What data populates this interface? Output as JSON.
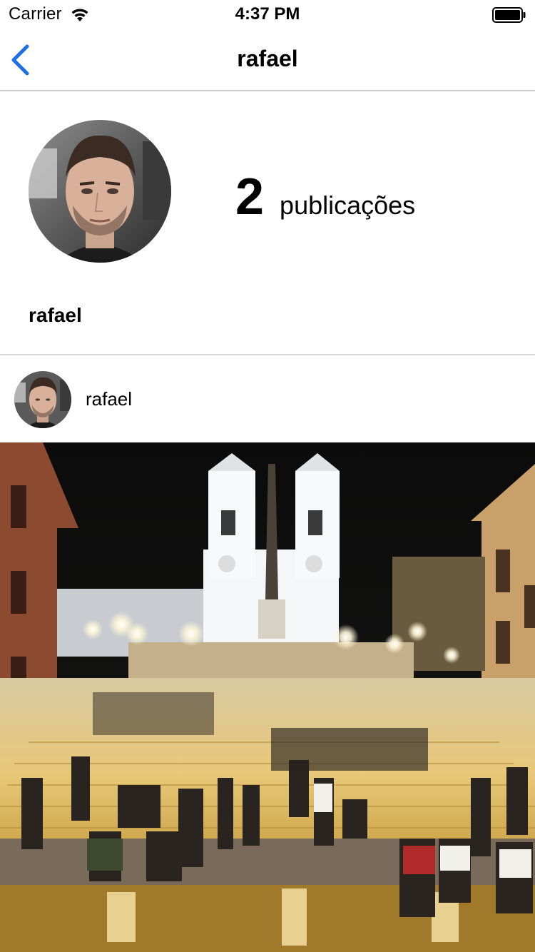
{
  "status_bar": {
    "carrier": "Carrier",
    "time": "4:37 PM",
    "wifi_icon": "wifi-icon",
    "battery_icon": "battery-icon",
    "battery_level": 1.0
  },
  "nav": {
    "title": "rafael",
    "back_icon": "chevron-left-icon",
    "accent_color": "#1e6fe6"
  },
  "profile": {
    "avatar_icon": "profile-avatar-photo",
    "post_count": "2",
    "post_count_label": "publicações",
    "name": "rafael"
  },
  "post": {
    "avatar_icon": "post-avatar-photo",
    "username": "rafael",
    "image_icon": "post-photo-night-square-with-church"
  }
}
